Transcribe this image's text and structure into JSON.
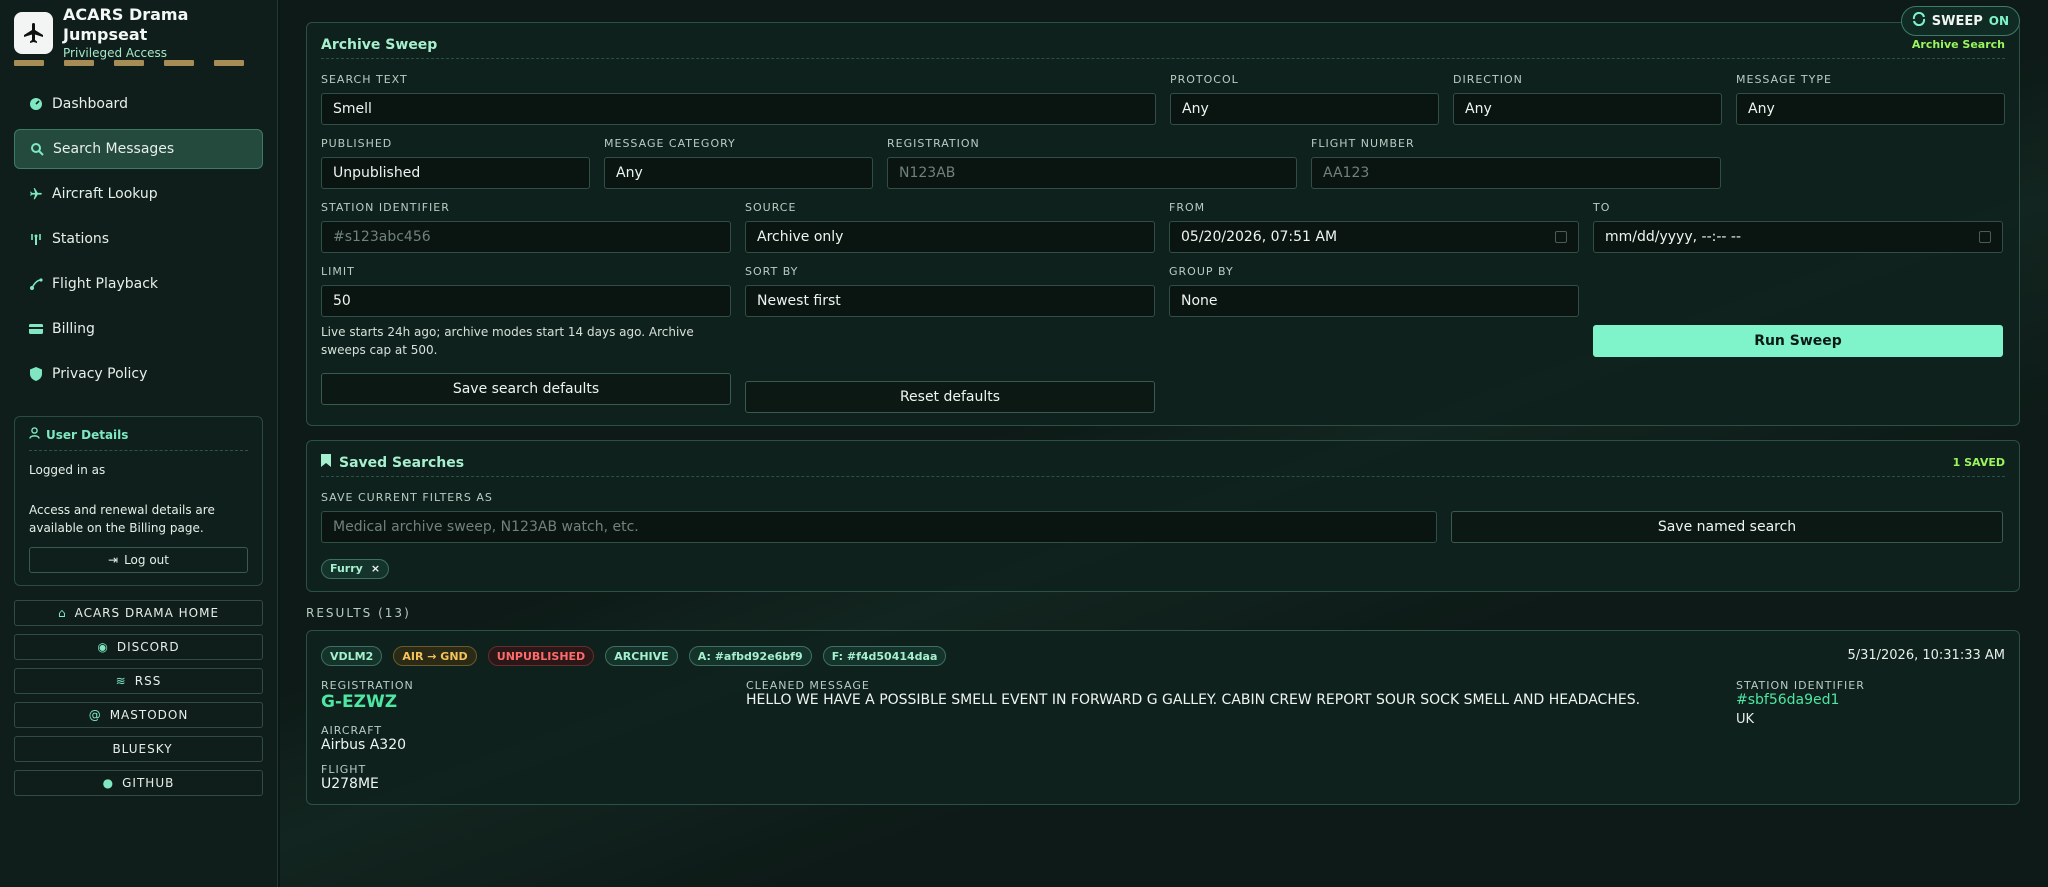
{
  "app": {
    "title": "ACARS Drama Jumpseat",
    "subtitle": "Privileged Access"
  },
  "nav": [
    {
      "label": "Dashboard",
      "icon": "gauge-icon"
    },
    {
      "label": "Search Messages",
      "icon": "search-icon",
      "active": true
    },
    {
      "label": "Aircraft Lookup",
      "icon": "plane-icon"
    },
    {
      "label": "Stations",
      "icon": "antenna-icon"
    },
    {
      "label": "Flight Playback",
      "icon": "playback-icon"
    },
    {
      "label": "Billing",
      "icon": "card-icon"
    },
    {
      "label": "Privacy Policy",
      "icon": "shield-icon"
    }
  ],
  "user": {
    "title": "User Details",
    "logged_in": "Logged in as",
    "access": "Access and renewal details are available on the Billing page.",
    "logout": "Log out"
  },
  "links": [
    {
      "label": "ACARS DRAMA HOME",
      "glyph": "⌂"
    },
    {
      "label": "DISCORD",
      "glyph": "◉"
    },
    {
      "label": "RSS",
      "glyph": "≋"
    },
    {
      "label": "MASTODON",
      "glyph": "@"
    },
    {
      "label": "BLUESKY",
      "glyph": ""
    },
    {
      "label": "GITHUB",
      "glyph": "●"
    }
  ],
  "sweep": {
    "label": "SWEEP",
    "state": "ON"
  },
  "archive": {
    "title": "Archive Sweep",
    "tag": "Archive Search",
    "search_text": {
      "label": "SEARCH TEXT",
      "value": "Smell"
    },
    "protocol": {
      "label": "PROTOCOL",
      "value": "Any"
    },
    "direction": {
      "label": "DIRECTION",
      "value": "Any"
    },
    "message_type": {
      "label": "MESSAGE TYPE",
      "value": "Any"
    },
    "published": {
      "label": "PUBLISHED",
      "value": "Unpublished"
    },
    "category": {
      "label": "MESSAGE CATEGORY",
      "value": "Any"
    },
    "registration": {
      "label": "REGISTRATION",
      "placeholder": "N123AB"
    },
    "flight": {
      "label": "FLIGHT NUMBER",
      "placeholder": "AA123"
    },
    "station": {
      "label": "STATION IDENTIFIER",
      "placeholder": "#s123abc456"
    },
    "source": {
      "label": "SOURCE",
      "value": "Archive only"
    },
    "from": {
      "label": "FROM",
      "value": "05/20/2026, 07:51 AM"
    },
    "to": {
      "label": "TO",
      "value": "mm/dd/yyyy, --:-- --"
    },
    "limit": {
      "label": "LIMIT",
      "value": "50"
    },
    "sort": {
      "label": "SORT BY",
      "value": "Newest first"
    },
    "group": {
      "label": "GROUP BY",
      "value": "None"
    },
    "hint": "Live starts 24h ago; archive modes start 14 days ago. Archive sweeps cap at 500.",
    "save_defaults": "Save search defaults",
    "reset_defaults": "Reset defaults",
    "run": "Run Sweep"
  },
  "saved": {
    "title": "Saved Searches",
    "count": "1 SAVED",
    "label": "SAVE CURRENT FILTERS AS",
    "placeholder": "Medical archive sweep, N123AB watch, etc.",
    "save_button": "Save named search",
    "tags": [
      "Furry"
    ]
  },
  "results": {
    "label": "RESULTS (13)",
    "items": [
      {
        "chips": [
          "VDLM2",
          "AIR → GND",
          "UNPUBLISHED",
          "ARCHIVE",
          "A: #afbd92e6bf9",
          "F: #f4d50414daa"
        ],
        "timestamp": "5/31/2026, 10:31:33 AM",
        "registration_label": "REGISTRATION",
        "registration": "G-EZWZ",
        "aircraft_label": "AIRCRAFT",
        "aircraft": "Airbus A320",
        "flight_label": "FLIGHT",
        "flight": "U278ME",
        "message_label": "CLEANED MESSAGE",
        "message": "HELLO WE HAVE A POSSIBLE SMELL EVENT IN FORWARD G GALLEY. CABIN CREW REPORT SOUR SOCK SMELL AND HEADACHES.",
        "station_label": "STATION IDENTIFIER",
        "station": "#sbf56da9ed1",
        "country": "UK"
      }
    ]
  },
  "colors": {
    "accent": "#7ff4cb",
    "bg": "#0b1714",
    "amber": "#f4c35a",
    "red": "#ff6a6a",
    "lime": "#9bf55e"
  }
}
